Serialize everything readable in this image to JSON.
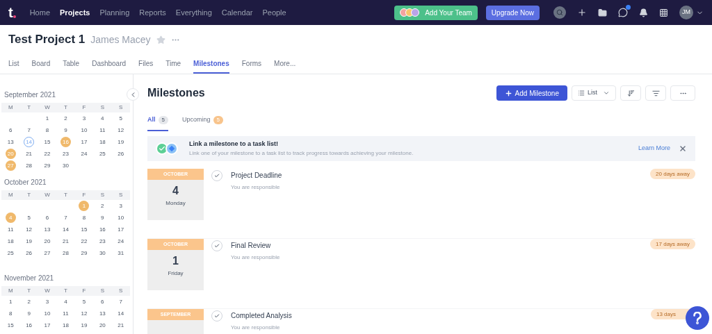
{
  "nav": {
    "logo": "t",
    "links": [
      {
        "label": "Home",
        "selected": false
      },
      {
        "label": "Projects",
        "selected": true
      },
      {
        "label": "Planning",
        "selected": false
      },
      {
        "label": "Reports",
        "selected": false
      },
      {
        "label": "Everything",
        "selected": false
      },
      {
        "label": "Calendar",
        "selected": false
      },
      {
        "label": "People",
        "selected": false
      }
    ],
    "team_button": "Add Your Team",
    "upgrade_button": "Upgrade Now",
    "avatar": "JM"
  },
  "project": {
    "title": "Test Project 1",
    "owner": "James Macey",
    "tabs": [
      {
        "label": "List",
        "selected": false
      },
      {
        "label": "Board",
        "selected": false
      },
      {
        "label": "Table",
        "selected": false
      },
      {
        "label": "Dashboard",
        "selected": false
      },
      {
        "label": "Files",
        "selected": false
      },
      {
        "label": "Time",
        "selected": false
      },
      {
        "label": "Milestones",
        "selected": true
      },
      {
        "label": "Forms",
        "selected": false
      },
      {
        "label": "More...",
        "selected": false
      }
    ]
  },
  "calendar": {
    "months": [
      {
        "title": "September 2021",
        "weekdays": [
          "M",
          "T",
          "W",
          "T",
          "F",
          "S",
          "S"
        ],
        "weeks": [
          [
            {
              "day": "1",
              "kind": "plain"
            },
            {
              "day": "2",
              "kind": "plain"
            },
            {
              "day": "3",
              "kind": "plain"
            },
            {
              "day": "4",
              "kind": "plain"
            },
            {
              "day": "5",
              "kind": "plain"
            }
          ],
          [
            {
              "day": "6",
              "kind": "plain"
            },
            {
              "day": "7",
              "kind": "plain"
            },
            {
              "day": "8",
              "kind": "plain"
            },
            {
              "day": "9",
              "kind": "plain"
            },
            {
              "day": "10",
              "kind": "plain"
            },
            {
              "day": "11",
              "kind": "plain"
            },
            {
              "day": "12",
              "kind": "plain"
            }
          ],
          [
            {
              "day": "13",
              "kind": "plain"
            },
            {
              "day": "14",
              "kind": "today"
            },
            {
              "day": "15",
              "kind": "plain"
            },
            {
              "day": "16",
              "kind": "milestone"
            },
            {
              "day": "17",
              "kind": "plain"
            },
            {
              "day": "18",
              "kind": "plain"
            },
            {
              "day": "19",
              "kind": "plain"
            }
          ],
          [
            {
              "day": "20",
              "kind": "milestone"
            },
            {
              "day": "21",
              "kind": "plain"
            },
            {
              "day": "22",
              "kind": "plain"
            },
            {
              "day": "23",
              "kind": "plain"
            },
            {
              "day": "24",
              "kind": "plain"
            },
            {
              "day": "25",
              "kind": "plain"
            },
            {
              "day": "26",
              "kind": "plain"
            }
          ],
          [
            {
              "day": "27",
              "kind": "milestone"
            },
            {
              "day": "28",
              "kind": "plain"
            },
            {
              "day": "29",
              "kind": "plain"
            },
            {
              "day": "30",
              "kind": "plain"
            }
          ]
        ]
      },
      {
        "title": "October 2021",
        "weekdays": [
          "M",
          "T",
          "W",
          "T",
          "F",
          "S",
          "S"
        ],
        "weeks": [
          [
            {
              "day": "1",
              "kind": "milestone"
            },
            {
              "day": "2",
              "kind": "plain"
            },
            {
              "day": "3",
              "kind": "plain"
            }
          ],
          [
            {
              "day": "4",
              "kind": "milestone"
            },
            {
              "day": "5",
              "kind": "plain"
            },
            {
              "day": "6",
              "kind": "plain"
            },
            {
              "day": "7",
              "kind": "plain"
            },
            {
              "day": "8",
              "kind": "plain"
            },
            {
              "day": "9",
              "kind": "plain"
            },
            {
              "day": "10",
              "kind": "plain"
            }
          ],
          [
            {
              "day": "11",
              "kind": "plain"
            },
            {
              "day": "12",
              "kind": "plain"
            },
            {
              "day": "13",
              "kind": "plain"
            },
            {
              "day": "14",
              "kind": "plain"
            },
            {
              "day": "15",
              "kind": "plain"
            },
            {
              "day": "16",
              "kind": "plain"
            },
            {
              "day": "17",
              "kind": "plain"
            }
          ],
          [
            {
              "day": "18",
              "kind": "plain"
            },
            {
              "day": "19",
              "kind": "plain"
            },
            {
              "day": "20",
              "kind": "plain"
            },
            {
              "day": "21",
              "kind": "plain"
            },
            {
              "day": "22",
              "kind": "plain"
            },
            {
              "day": "23",
              "kind": "plain"
            },
            {
              "day": "24",
              "kind": "plain"
            }
          ],
          [
            {
              "day": "25",
              "kind": "plain"
            },
            {
              "day": "26",
              "kind": "plain"
            },
            {
              "day": "27",
              "kind": "plain"
            },
            {
              "day": "28",
              "kind": "plain"
            },
            {
              "day": "29",
              "kind": "plain"
            },
            {
              "day": "30",
              "kind": "plain"
            },
            {
              "day": "31",
              "kind": "plain"
            }
          ]
        ]
      },
      {
        "title": "November 2021",
        "weekdays": [
          "M",
          "T",
          "W",
          "T",
          "F",
          "S",
          "S"
        ],
        "weeks": [
          [
            {
              "day": "1",
              "kind": "plain"
            },
            {
              "day": "2",
              "kind": "plain"
            },
            {
              "day": "3",
              "kind": "plain"
            },
            {
              "day": "4",
              "kind": "plain"
            },
            {
              "day": "5",
              "kind": "plain"
            },
            {
              "day": "6",
              "kind": "plain"
            },
            {
              "day": "7",
              "kind": "plain"
            }
          ],
          [
            {
              "day": "8",
              "kind": "plain"
            },
            {
              "day": "9",
              "kind": "plain"
            },
            {
              "day": "10",
              "kind": "plain"
            },
            {
              "day": "11",
              "kind": "plain"
            },
            {
              "day": "12",
              "kind": "plain"
            },
            {
              "day": "13",
              "kind": "plain"
            },
            {
              "day": "14",
              "kind": "plain"
            }
          ],
          [
            {
              "day": "15",
              "kind": "plain"
            },
            {
              "day": "16",
              "kind": "plain"
            },
            {
              "day": "17",
              "kind": "plain"
            },
            {
              "day": "18",
              "kind": "plain"
            },
            {
              "day": "19",
              "kind": "plain"
            },
            {
              "day": "20",
              "kind": "plain"
            },
            {
              "day": "21",
              "kind": "plain"
            }
          ]
        ]
      }
    ]
  },
  "milestones": {
    "title": "Milestones",
    "add_button": "Add Milestone",
    "view_button": "List",
    "filters": [
      {
        "label": "All",
        "count": "5",
        "selected": true,
        "color": "#e5e7eb"
      },
      {
        "label": "Upcoming",
        "count": "5",
        "selected": false,
        "color": "#f8c48c"
      }
    ],
    "banner": {
      "title": "Link a milestone to a task list!",
      "text": "Link one of your milestone to a task list to track progress towards achieving your milestone.",
      "link": "Learn More"
    },
    "items": [
      {
        "month": "OCTOBER",
        "day": "4",
        "weekday": "Monday",
        "name": "Project Deadline",
        "note": "You are responsible",
        "due": "20 days away"
      },
      {
        "month": "OCTOBER",
        "day": "1",
        "weekday": "Friday",
        "name": "Final Review",
        "note": "You are responsible",
        "due": "17 days away"
      },
      {
        "month": "SEPTEMBER",
        "name": "Completed Analysis",
        "note": "You are responsible",
        "due": "13 days"
      }
    ]
  }
}
